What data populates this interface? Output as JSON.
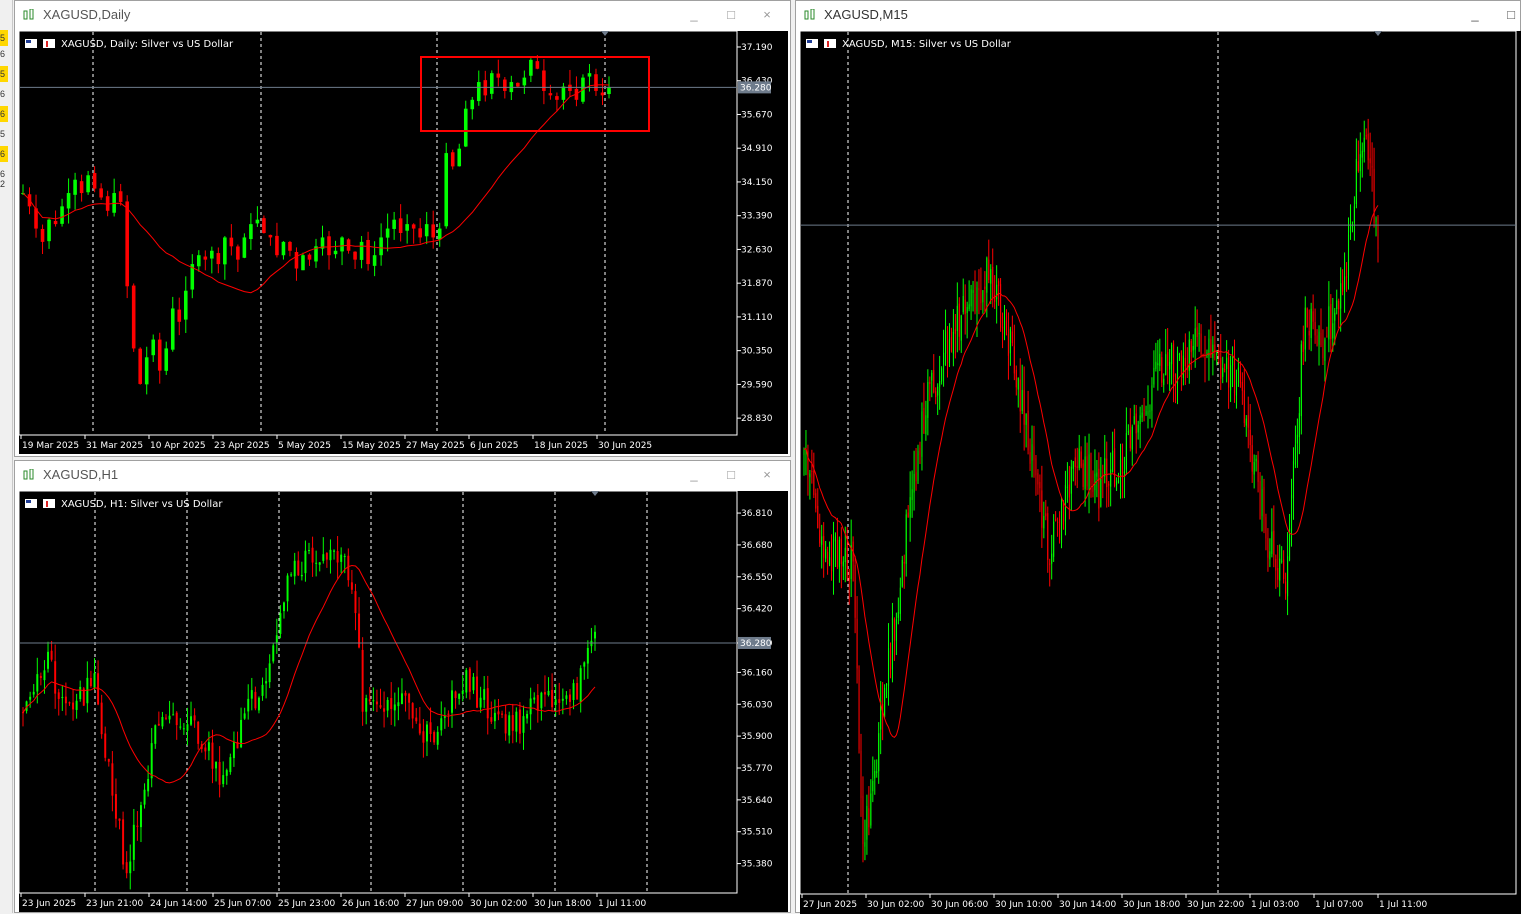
{
  "colors": {
    "bull": "#00ff00",
    "bear": "#ff0000",
    "ma": "#ff0000",
    "bid_line": "#6e7b8b",
    "grid": "#ffffff",
    "bg": "#000000",
    "highlight": "#ff0000"
  },
  "left_strip": {
    "marks": [
      "5",
      "6",
      "5",
      "6",
      "6",
      "5",
      "6",
      "6",
      "2"
    ]
  },
  "windows": {
    "daily": {
      "title": "XAGUSD,Daily",
      "subtitle": "XAGUSD, Daily:  Silver vs US Dollar",
      "min": "_",
      "max": "□",
      "close": "×",
      "price_labels": [
        "37.190",
        "36.430",
        "35.670",
        "34.910",
        "34.150",
        "33.390",
        "32.630",
        "31.870",
        "31.110",
        "30.350",
        "29.590",
        "28.830"
      ],
      "current_price": "36.280",
      "time_labels": [
        "19 Mar 2025",
        "31 Mar 2025",
        "10 Apr 2025",
        "23 Apr 2025",
        "5 May 2025",
        "15 May 2025",
        "27 May 2025",
        "6 Jun 2025",
        "18 Jun 2025",
        "30 Jun 2025"
      ]
    },
    "h1": {
      "title": "XAGUSD,H1",
      "subtitle": "XAGUSD, H1:  Silver vs US Dollar",
      "min": "_",
      "max": "□",
      "close": "×",
      "price_labels": [
        "36.810",
        "36.680",
        "36.550",
        "36.420",
        "36.280",
        "36.160",
        "36.030",
        "35.900",
        "35.770",
        "35.640",
        "35.510",
        "35.380"
      ],
      "current_price": "36.280",
      "time_labels": [
        "23 Jun 2025",
        "23 Jun 21:00",
        "24 Jun 14:00",
        "25 Jun 07:00",
        "25 Jun 23:00",
        "26 Jun 16:00",
        "27 Jun 09:00",
        "30 Jun 02:00",
        "30 Jun 18:00",
        "1 Jul 11:00"
      ]
    },
    "m15": {
      "title": "XAGUSD,M15",
      "subtitle": "XAGUSD, M15:  Silver vs US Dollar",
      "min": "_",
      "max": "□",
      "time_labels": [
        "27 Jun 2025",
        "30 Jun 02:00",
        "30 Jun 06:00",
        "30 Jun 10:00",
        "30 Jun 14:00",
        "30 Jun 18:00",
        "30 Jun 22:00",
        "1 Jul 03:00",
        "1 Jul 07:00",
        "1 Jul 11:00"
      ]
    }
  },
  "chart_data": [
    {
      "type": "candlestick",
      "title": "XAGUSD, Daily:  Silver vs US Dollar",
      "ylim": [
        28.45,
        37.55
      ],
      "current_price": 36.28,
      "ma_period_visible": true,
      "closes": [
        33.9,
        33.6,
        33.1,
        32.8,
        33.3,
        33.2,
        33.6,
        33.9,
        34.2,
        33.9,
        34.3,
        34.0,
        33.8,
        33.5,
        33.9,
        33.7,
        31.8,
        30.4,
        29.6,
        30.2,
        30.6,
        29.9,
        30.4,
        31.3,
        31.0,
        31.7,
        32.3,
        32.5,
        32.4,
        32.6,
        32.3,
        32.9,
        32.7,
        32.4,
        32.9,
        33.2,
        33.3,
        33.0,
        32.9,
        32.5,
        32.8,
        32.6,
        32.2,
        32.5,
        32.4,
        32.7,
        32.9,
        32.5,
        32.6,
        32.9,
        32.6,
        32.4,
        32.8,
        32.3,
        32.5,
        32.9,
        33.1,
        33.3,
        33.0,
        33.2,
        33.1,
        32.9,
        33.2,
        32.9,
        33.1,
        34.8,
        34.5,
        34.9,
        35.8,
        36.0,
        36.4,
        36.1,
        36.6,
        36.5,
        36.2,
        36.4,
        36.3,
        36.5,
        36.9,
        36.7,
        36.2,
        36.1,
        36.0,
        36.3,
        36.2,
        36.0,
        36.5,
        36.6,
        36.2,
        36.1,
        36.28
      ],
      "highlight_box": "last-month range"
    },
    {
      "type": "candlestick",
      "title": "XAGUSD, H1:  Silver vs US Dollar",
      "ylim": [
        35.26,
        36.9
      ],
      "current_price": 36.28
    },
    {
      "type": "candlestick",
      "title": "XAGUSD, M15:  Silver vs US Dollar",
      "current_price": 36.28
    }
  ]
}
